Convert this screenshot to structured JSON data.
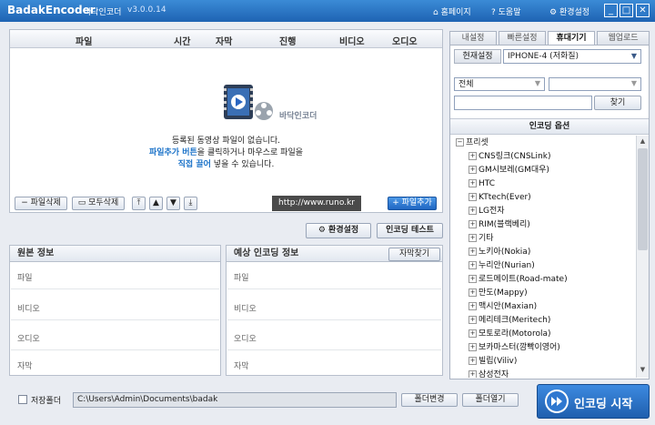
{
  "app": {
    "name": "BadakEncoder",
    "name_ko": "바닥인코더",
    "version": "v3.0.0.14"
  },
  "titlebar": {
    "home": "홈페이지",
    "help": "도움말",
    "settings": "환경설정",
    "min": "_",
    "max": "□",
    "close": "✕"
  },
  "file_list": {
    "columns": [
      "파일",
      "시간",
      "자막",
      "진행",
      "비디오",
      "오디오"
    ],
    "logo_text": "바닥인코더",
    "empty_line1": "등록된 동영상 파일이 없습니다.",
    "empty_line2_hl": "파일추가 버튼",
    "empty_line2_rest": "을 클릭하거나 마우스로 파일을",
    "empty_line3_hl": "직접 끌어",
    "empty_line3_rest": " 넣을 수 있습니다.",
    "url": "http://www.runo.kr",
    "btn_delete": "파일삭제",
    "btn_delete_all": "모두삭제",
    "btn_add": "파일추가"
  },
  "actions": {
    "settings": "환경설정",
    "test": "인코딩 테스트"
  },
  "source_info": {
    "title": "원본 정보",
    "rows": [
      "파일",
      "비디오",
      "오디오",
      "자막"
    ]
  },
  "expected_info": {
    "title": "예상 인코딩 정보",
    "find_sub": "자막찾기",
    "rows": [
      "파일",
      "비디오",
      "오디오",
      "자막"
    ]
  },
  "save": {
    "label": "저장폴더",
    "path": "C:\\Users\\Admin\\Documents\\badak",
    "change": "폴더변경",
    "open": "폴더열기"
  },
  "start_button": "인코딩 시작",
  "right": {
    "tabs": [
      "내설정",
      "빠른설정",
      "휴대기기",
      "웹업로드"
    ],
    "active_tab": "휴대기기",
    "current_label": "현재설정",
    "current_value": "IPHONE-4 (저화질)",
    "filter_value": "전체",
    "search_button": "찾기",
    "options_title": "인코딩 옵션",
    "tree_root": "프리셋",
    "tree_items": [
      "CNS링크(CNSLink)",
      "GM시보레(GM대우)",
      "HTC",
      "KTtech(Ever)",
      "LG전자",
      "RIM(블랙베리)",
      "기타",
      "노키아(Nokia)",
      "누리안(Nurian)",
      "로드메이트(Road-mate)",
      "만도(Mappy)",
      "맥시안(Maxian)",
      "메리테크(Meritech)",
      "모토로라(Motorola)",
      "보카마스터(깜빡이영어)",
      "빌립(Viliv)",
      "삼성전자"
    ]
  },
  "colors": {
    "titlebar": "#1e63b3",
    "accent": "#2478d4",
    "highlight": "#1a72c8",
    "start": "#1f5fae"
  }
}
